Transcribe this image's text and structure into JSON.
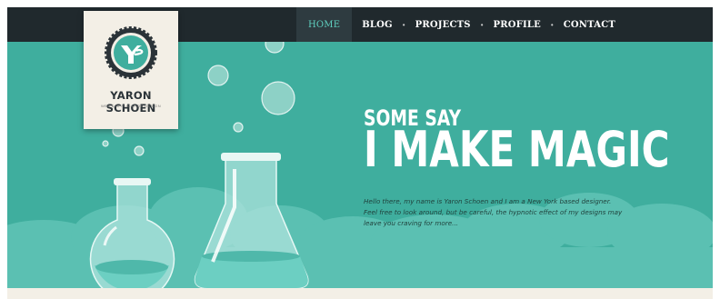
{
  "brand": {
    "name": "YARON SCHOEN",
    "tagline": "WEB & APPLICATION DESIGN",
    "monogram_icon": "ys-badge-icon"
  },
  "nav": {
    "items": [
      {
        "label": "HOME",
        "active": true
      },
      {
        "label": "BLOG",
        "active": false
      },
      {
        "label": "PROJECTS",
        "active": false
      },
      {
        "label": "PROFILE",
        "active": false
      },
      {
        "label": "CONTACT",
        "active": false
      }
    ],
    "separator": "•"
  },
  "hero": {
    "headline_small": "SOME SAY",
    "headline_big": "I MAKE MAGIC",
    "intro_lines": [
      "Hello there, my name is Yaron Schoen and I am a New York based designer.",
      "Feel free to look around, but be careful, the hypnotic effect of my designs may",
      "leave you craving for more..."
    ]
  },
  "colors": {
    "topbar": "#20292d",
    "hero_bg": "#3fae9e",
    "cloud": "#5bc0b2",
    "card": "#f3efe6",
    "accent": "#5fd0c0"
  },
  "illustration": {
    "items": [
      "round-flask-icon",
      "erlenmeyer-flask-icon",
      "bubble-icon"
    ]
  }
}
